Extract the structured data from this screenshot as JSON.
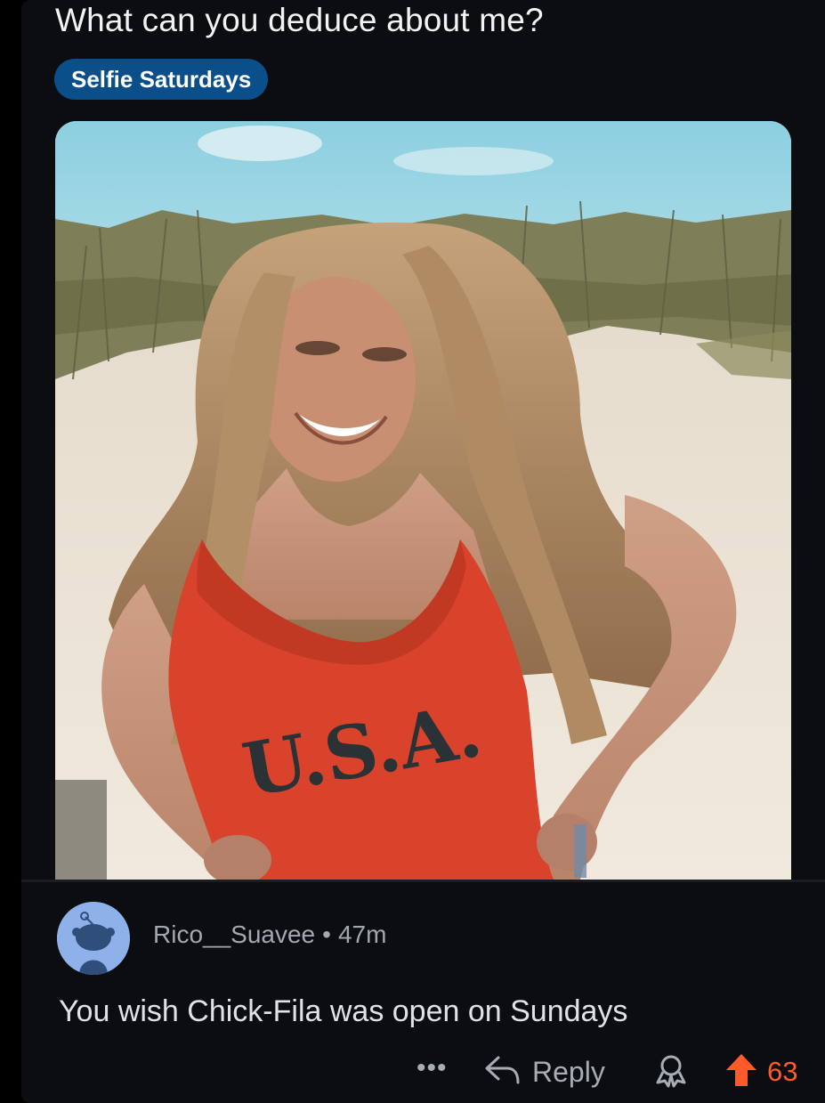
{
  "post": {
    "title": "What can you deduce about me?",
    "flair": "Selfie Saturdays",
    "image": {
      "shirt_text": "U.S.A."
    }
  },
  "comment": {
    "author": "Rico__Suavee",
    "separator": "•",
    "age": "47m",
    "body": "You wish Chick-Fila was open on Sundays",
    "actions": {
      "more_label": "•••",
      "reply_label": "Reply",
      "vote_count": "63"
    }
  },
  "icons": {
    "more": "more-dots-icon",
    "reply": "reply-arrow-icon",
    "award": "award-icon",
    "upvote": "upvote-arrow-icon",
    "avatar": "snoo-avatar-icon"
  },
  "colors": {
    "background": "#0b0d11",
    "flair": "#0b4f8a",
    "upvote": "#ff5a2c",
    "avatar": "#8fb1ea"
  }
}
